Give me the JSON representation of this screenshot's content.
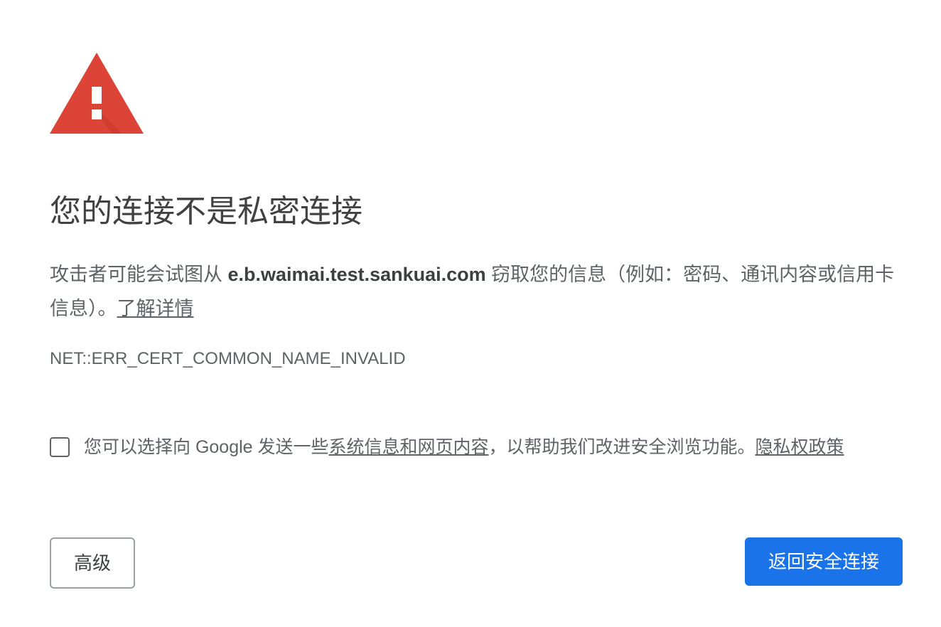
{
  "interstitial": {
    "icon": "warning-triangle-icon",
    "title": "您的连接不是私密连接",
    "explanation_prefix": "攻击者可能会试图从 ",
    "domain": "e.b.waimai.test.sankuai.com",
    "explanation_suffix": " 窃取您的信息（例如：密码、通讯内容或信用卡信息）。",
    "learn_more_link": "了解详情",
    "error_code": "NET::ERR_CERT_COMMON_NAME_INVALID"
  },
  "optin": {
    "checked": false,
    "text_prefix": "您可以选择向 Google 发送一些",
    "system_info_link": "系统信息和网页内容",
    "text_middle": "，以帮助我们改进安全浏览功能。",
    "privacy_link": "隐私权政策"
  },
  "buttons": {
    "advanced_label": "高级",
    "back_label": "返回安全连接"
  },
  "colors": {
    "warning_red": "#db4437",
    "primary_blue": "#1a73e8",
    "text_gray": "#5f6368"
  }
}
